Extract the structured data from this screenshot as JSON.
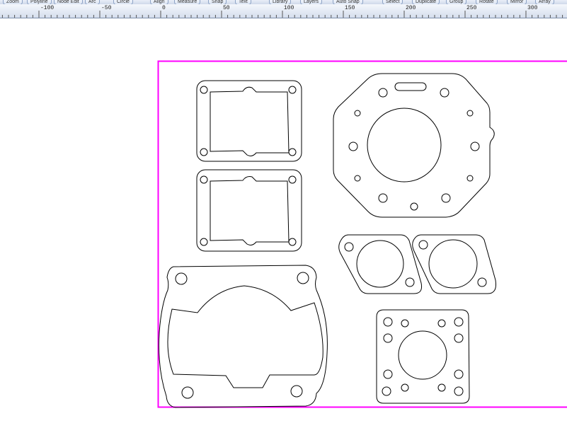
{
  "toolbar": {
    "buttons": [
      {
        "name": "zoom",
        "label": "Zoom"
      },
      {
        "name": "polyline",
        "label": "Polyline"
      },
      {
        "name": "node-edit",
        "label": "Node Edit"
      },
      {
        "name": "arc",
        "label": "Arc"
      },
      {
        "name": "circle",
        "label": "Circle"
      },
      {
        "name": "align",
        "label": "Align"
      },
      {
        "name": "measure",
        "label": "Measure"
      },
      {
        "name": "snap",
        "label": "Snap"
      },
      {
        "name": "text",
        "label": "Text"
      },
      {
        "name": "library",
        "label": "Library"
      },
      {
        "name": "layers",
        "label": "Layers"
      },
      {
        "name": "auto-snap",
        "label": "Auto Snap"
      },
      {
        "name": "select",
        "label": "Select"
      },
      {
        "name": "duplicate",
        "label": "Duplicate"
      },
      {
        "name": "group",
        "label": "Group"
      },
      {
        "name": "rotate",
        "label": "Rotate"
      },
      {
        "name": "mirror",
        "label": "Mirror"
      },
      {
        "name": "array",
        "label": "Array"
      }
    ]
  },
  "ruler": {
    "labels": [
      "-100",
      "-50",
      "0",
      "50",
      "100",
      "150",
      "200",
      "250",
      "300"
    ]
  },
  "canvas": {
    "border_color": "#ff00ff",
    "line_color": "#000000"
  }
}
